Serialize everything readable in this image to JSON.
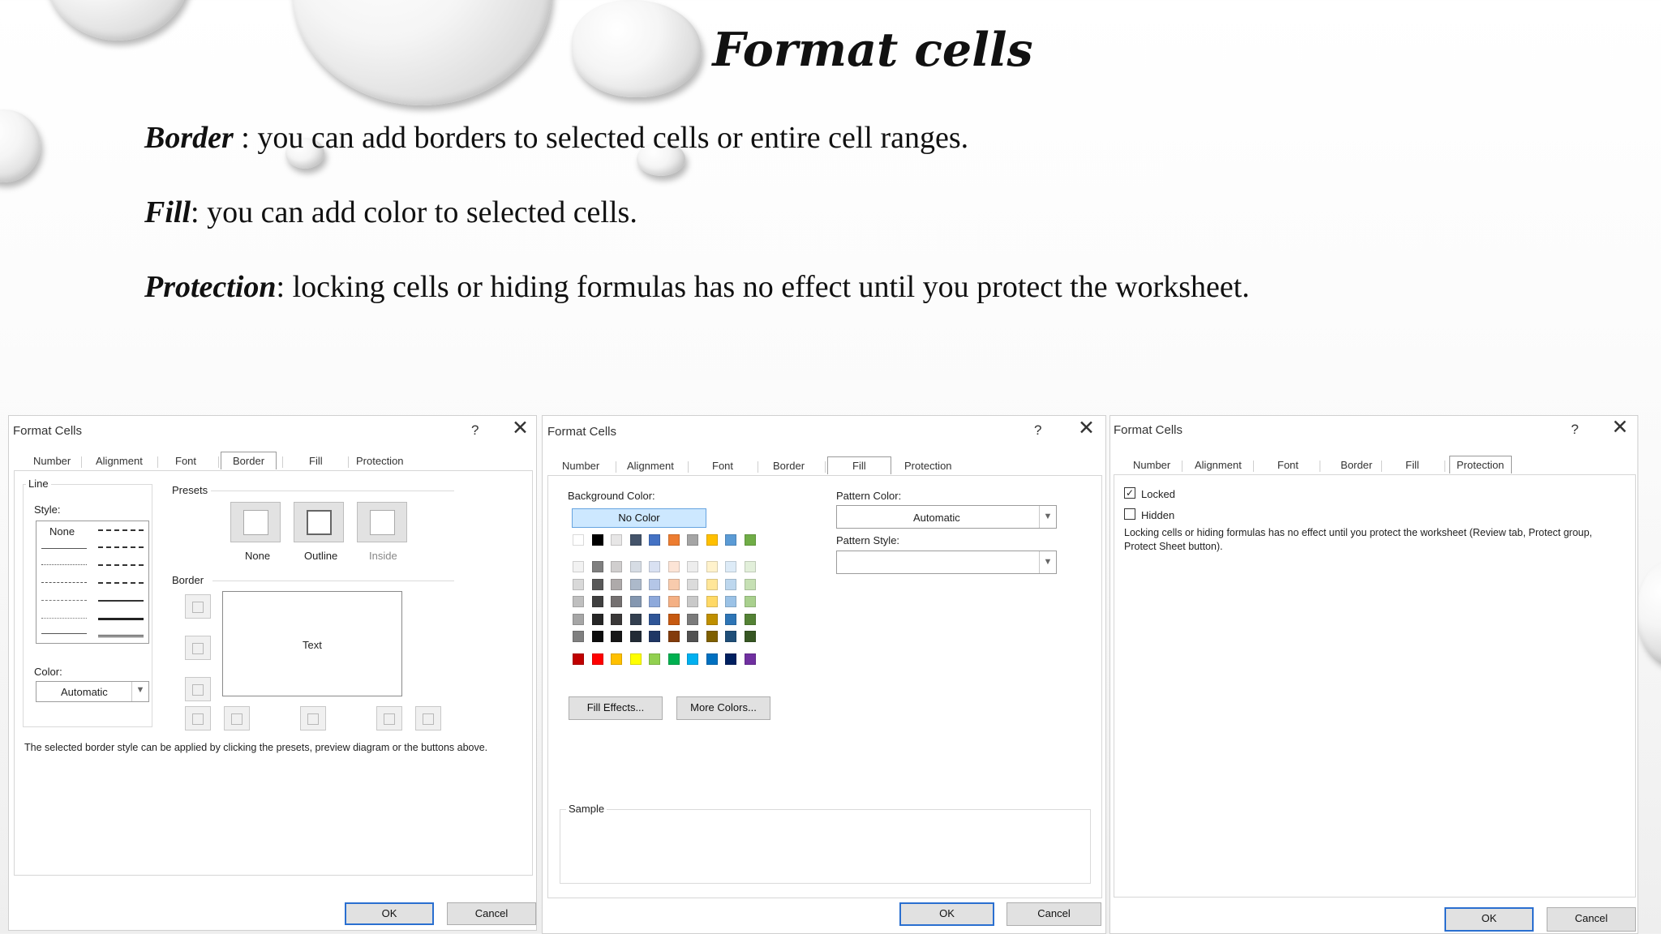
{
  "slide": {
    "title": "Format cells",
    "bullets": [
      {
        "term": "Border",
        "text": " : you can add borders to selected cells or entire cell ranges."
      },
      {
        "term": "Fill",
        "text": ": you can add color to selected cells."
      },
      {
        "term": "Protection",
        "text": ": locking cells or hiding formulas has no effect until you protect the worksheet."
      }
    ]
  },
  "dialog_border": {
    "title": "Format Cells",
    "help_icon": "?",
    "close_icon": "✕",
    "tabs": [
      "Number",
      "Alignment",
      "Font",
      "Border",
      "Fill",
      "Protection"
    ],
    "active_tab": "Border",
    "line_group": "Line",
    "style_label": "Style:",
    "style_none": "None",
    "color_label": "Color:",
    "color_value": "Automatic",
    "presets_label": "Presets",
    "preset_none": "None",
    "preset_outline": "Outline",
    "preset_inside": "Inside",
    "border_label": "Border",
    "preview_text": "Text",
    "hint": "The selected border style can be applied by clicking the presets, preview diagram or the buttons above.",
    "ok": "OK",
    "cancel": "Cancel"
  },
  "dialog_fill": {
    "title": "Format Cells",
    "help_icon": "?",
    "close_icon": "✕",
    "tabs": [
      "Number",
      "Alignment",
      "Font",
      "Border",
      "Fill",
      "Protection"
    ],
    "active_tab": "Fill",
    "background_color_label": "Background Color:",
    "no_color": "No Color",
    "pattern_color_label": "Pattern Color:",
    "pattern_color_value": "Automatic",
    "pattern_style_label": "Pattern Style:",
    "fill_effects": "Fill Effects...",
    "more_colors": "More Colors...",
    "sample_label": "Sample",
    "ok": "OK",
    "cancel": "Cancel",
    "theme_row": [
      "#ffffff",
      "#000000",
      "#e7e6e6",
      "#44546a",
      "#4472c4",
      "#ed7d31",
      "#a5a5a5",
      "#ffc000",
      "#5b9bd5",
      "#70ad47"
    ],
    "shade_rows": [
      [
        "#f2f2f2",
        "#7f7f7f",
        "#d0cece",
        "#d6dce4",
        "#d9e1f2",
        "#fce4d6",
        "#ededed",
        "#fff2cc",
        "#ddebf7",
        "#e2efda"
      ],
      [
        "#d9d9d9",
        "#595959",
        "#aeaaaa",
        "#acb9ca",
        "#b4c6e7",
        "#f8cbad",
        "#dbdbdb",
        "#ffe699",
        "#bdd7ee",
        "#c6e0b4"
      ],
      [
        "#bfbfbf",
        "#404040",
        "#757171",
        "#8497b0",
        "#8ea9db",
        "#f4b084",
        "#c9c9c9",
        "#ffd966",
        "#9bc2e6",
        "#a9d08e"
      ],
      [
        "#a6a6a6",
        "#262626",
        "#3a3838",
        "#333f4f",
        "#2f5597",
        "#c65911",
        "#7b7b7b",
        "#bf8f00",
        "#2e75b6",
        "#548235"
      ],
      [
        "#808080",
        "#0d0d0d",
        "#161616",
        "#222b35",
        "#203764",
        "#833c0c",
        "#525252",
        "#7f6000",
        "#1f4e78",
        "#375623"
      ]
    ],
    "standard_row": [
      "#c00000",
      "#ff0000",
      "#ffc000",
      "#ffff00",
      "#92d050",
      "#00b050",
      "#00b0f0",
      "#0070c0",
      "#002060",
      "#7030a0"
    ]
  },
  "dialog_protection": {
    "title": "Format Cells",
    "help_icon": "?",
    "close_icon": "✕",
    "tabs": [
      "Number",
      "Alignment",
      "Font",
      "Border",
      "Fill",
      "Protection"
    ],
    "active_tab": "Protection",
    "locked_label": "Locked",
    "locked_checked": true,
    "hidden_label": "Hidden",
    "hidden_checked": false,
    "note_line1": "Locking cells or hiding formulas has no effect until you protect the worksheet (Review tab, Protect group,",
    "note_line2": "Protect Sheet button).",
    "ok": "OK",
    "cancel": "Cancel"
  }
}
